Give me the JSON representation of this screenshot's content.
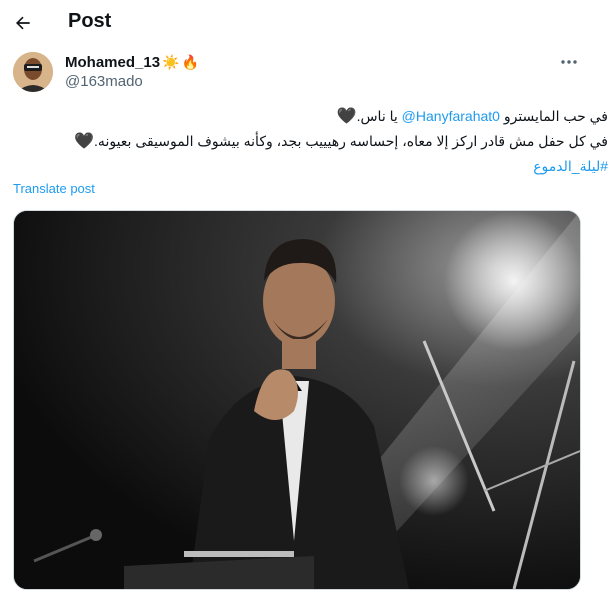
{
  "header": {
    "back_icon": "arrow-left-icon",
    "title": "Post"
  },
  "author": {
    "display_name": "Mohamed_13",
    "badges": [
      "sun-emoji",
      "fire-emoji"
    ],
    "handle": "@163mado"
  },
  "post": {
    "line1_prefix": "في حب المايسترو ",
    "mention": "@Hanyfarahat0",
    "line1_suffix": " يا ناس.",
    "line2": "في كل حفل مش قادر اركز إلا معاه، إحساسه رهيييب بجد، وكأنه بيشوف الموسيقى بعيونه.",
    "hashtag": "#ليلة_الدموع",
    "heart_glyph": "🖤"
  },
  "translate_label": "Translate post",
  "colors": {
    "link": "#1d9bf0",
    "text": "#0f1419",
    "secondary": "#536471"
  }
}
